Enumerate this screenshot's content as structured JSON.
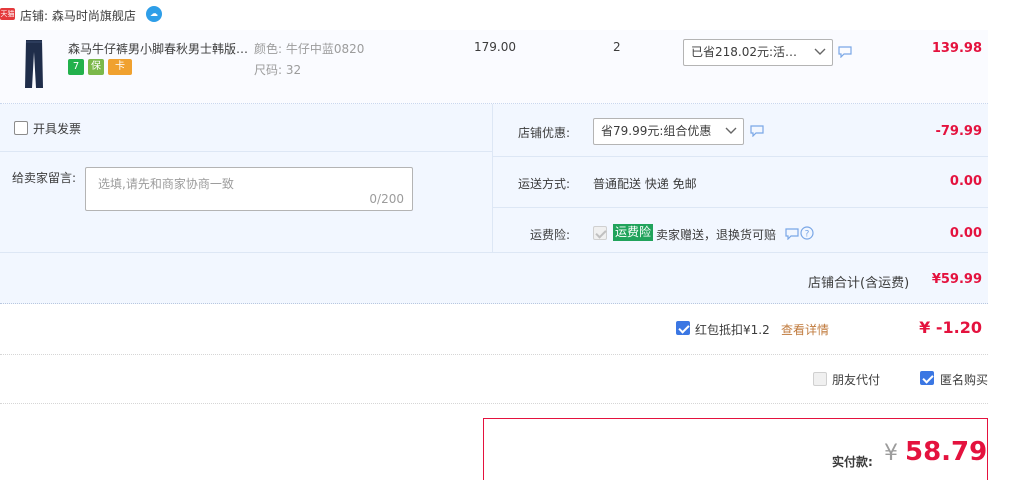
{
  "shop": {
    "badge_text": "天猫",
    "label": "店铺: 森马时尚旗舰店",
    "contact_icon": "wangwang-icon"
  },
  "item": {
    "title": "森马牛仔裤男小脚春秋男士韩版…",
    "service_icons": [
      "seven-day-return-icon",
      "guarantee-icon",
      "card-icon"
    ],
    "service_icon_texts": [
      "7",
      "保",
      "卡"
    ],
    "color_label": "颜色: 牛仔中蓝0820",
    "size_label": "尺码: 32",
    "unit_price": "179.00",
    "quantity": "2",
    "discount_select": "已省218.02元:活…",
    "subtotal": "139.98"
  },
  "options": {
    "invoice_label": "开具发票",
    "message_label": "给卖家留言:",
    "message_placeholder": "选填,请先和商家协商一致",
    "message_count": "0/200",
    "shop_discount_label": "店铺优惠:",
    "shop_discount_select": "省79.99元:组合优惠",
    "shop_discount_amount": "-79.99",
    "shipping_label": "运送方式:",
    "shipping_value": "普通配送 快递 免邮",
    "shipping_amount": "0.00",
    "insurance_label": "运费险:",
    "insurance_tag": "运费险",
    "insurance_text": "卖家赠送，退换货可赔",
    "insurance_amount": "0.00"
  },
  "shop_total": {
    "label": "店铺合计(含运费)",
    "value": "¥59.99"
  },
  "red_packet": {
    "label": "红包抵扣¥1.2",
    "link": "查看详情",
    "amount": "¥ -1.20"
  },
  "purchase_options": {
    "friend_pay": "朋友代付",
    "anonymous": "匿名购买"
  },
  "payment": {
    "label": "实付款:",
    "currency": "¥",
    "amount": "58.79"
  },
  "colors": {
    "accent_red": "#e4123e",
    "checkbox_blue": "#3b77e3",
    "insurance_green": "#21a35b",
    "panel_bg": "#f2f7ff"
  }
}
